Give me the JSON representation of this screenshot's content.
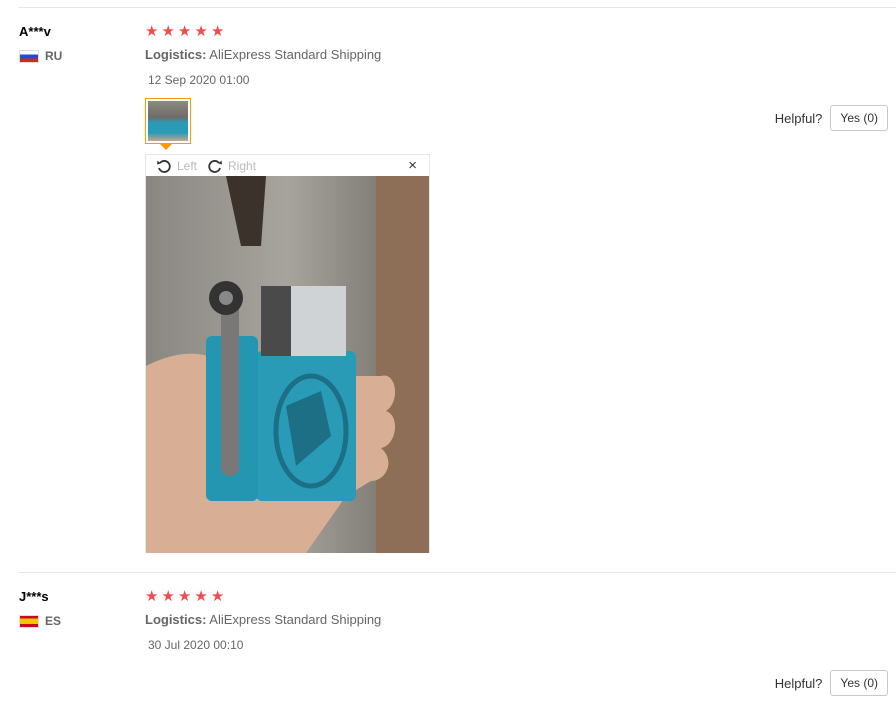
{
  "reviews": [
    {
      "user": "A***v",
      "country": "RU",
      "flag_icon": "flag-russia-icon",
      "rating": 5,
      "logistics_label": "Logistics:",
      "logistics_value": " AliExpress Standard Shipping",
      "date": "12 Sep 2020 01:00",
      "helpful_label": "Helpful?",
      "yes_label": "Yes (0)"
    },
    {
      "user": "J***s",
      "country": "ES",
      "flag_icon": "flag-spain-icon",
      "rating": 5,
      "logistics_label": "Logistics:",
      "logistics_value": " AliExpress Standard Shipping",
      "date": "30 Jul 2020 00:10",
      "helpful_label": "Helpful?",
      "yes_label": "Yes (0)"
    }
  ],
  "viewer": {
    "rotate_left": "Left",
    "rotate_right": "Right",
    "close": "×"
  },
  "colors": {
    "star": "#f04c4c",
    "thumb_border": "#ff9900",
    "tool_teal": "#2a9bb7"
  }
}
